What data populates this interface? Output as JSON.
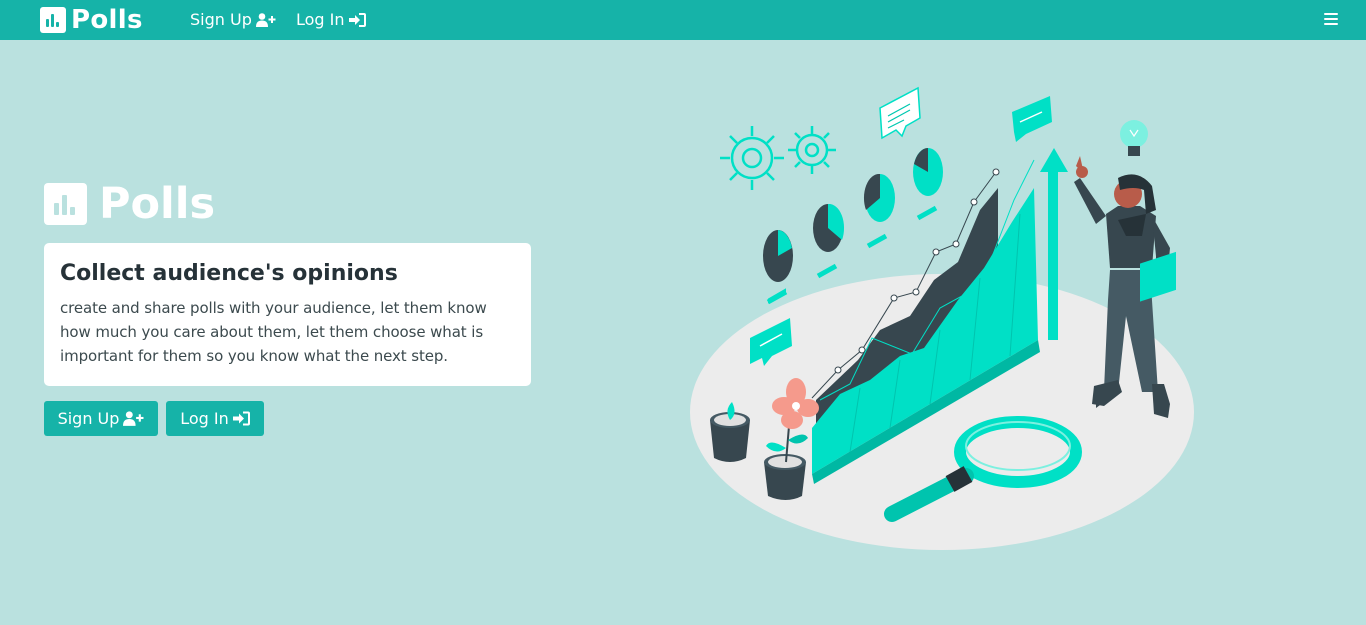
{
  "navbar": {
    "brand": "Polls",
    "links": [
      {
        "label": "Sign Up",
        "icon": "user-plus-icon"
      },
      {
        "label": "Log In",
        "icon": "sign-in-icon"
      }
    ],
    "menu_icon": "hamburger-icon"
  },
  "hero": {
    "brand": "Polls",
    "card_title": "Collect audience's opinions",
    "card_text": "create and share polls with your audience, let them know how much you care about them, let them choose what is important for them so you know what the next step.",
    "buttons": [
      {
        "label": "Sign Up",
        "icon": "user-plus-icon"
      },
      {
        "label": "Log In",
        "icon": "sign-in-icon"
      }
    ]
  },
  "colors": {
    "primary": "#16b3a8",
    "background": "#bae1df",
    "accent": "#00e0c6",
    "dark": "#37474f"
  }
}
